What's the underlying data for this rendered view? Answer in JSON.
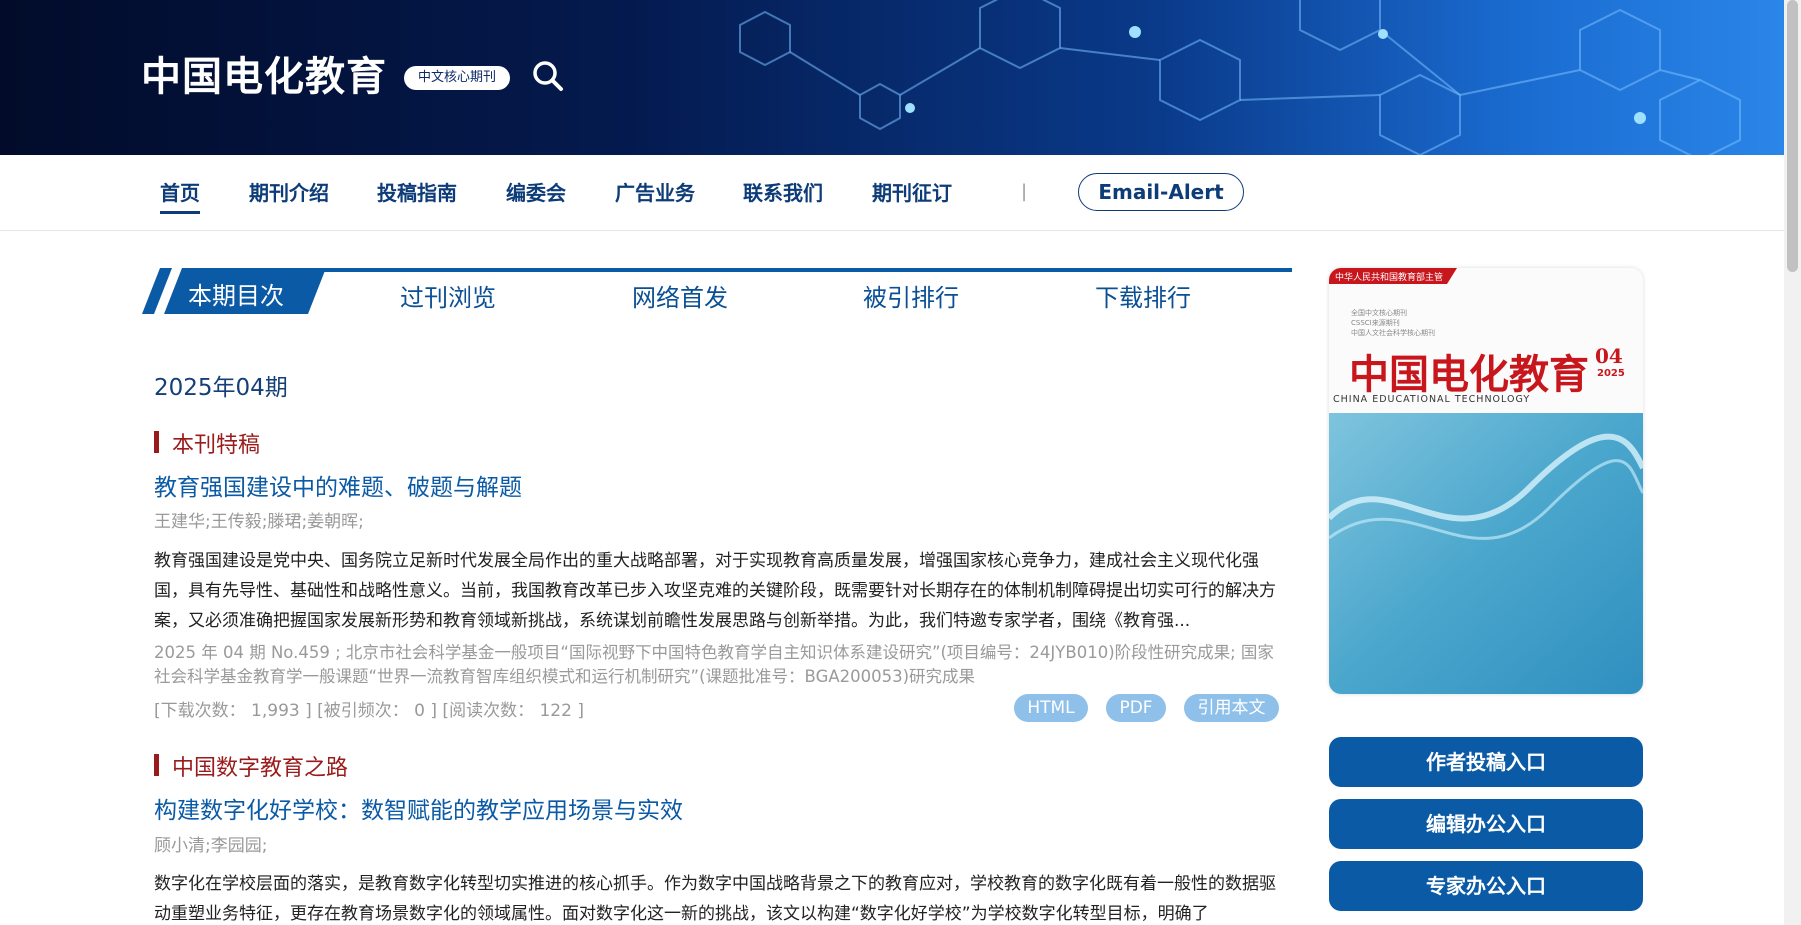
{
  "header": {
    "site_title": "中国电化教育",
    "badge": "中文核心期刊"
  },
  "nav": {
    "items": [
      "首页",
      "期刊介绍",
      "投稿指南",
      "编委会",
      "广告业务",
      "联系我们",
      "期刊征订"
    ],
    "separator": "|",
    "email_alert": "Email-Alert"
  },
  "tabs": [
    "本期目次",
    "过刊浏览",
    "网络首发",
    "被引排行",
    "下载排行"
  ],
  "issue_title": "2025年04期",
  "sections": [
    {
      "heading": "本刊特稿",
      "article": {
        "title": "教育强国建设中的难题、破题与解题",
        "authors": "王建华;王传毅;滕珺;姜朝晖;",
        "abstract": "教育强国建设是党中央、国务院立足新时代发展全局作出的重大战略部署，对于实现教育高质量发展，增强国家核心竞争力，建成社会主义现代化强国，具有先导性、基础性和战略性意义。当前，我国教育改革已步入攻坚克难的关键阶段，既需要针对长期存在的体制机制障碍提出切实可行的解决方案，又必须准确把握国家发展新形势和教育领域新挑战，系统谋划前瞻性发展思路与创新举措。为此，我们特邀专家学者，围绕《教育强...",
        "meta": "2025 年 04 期 No.459 ;  北京市社会科学基金一般项目“国际视野下中国特色教育学自主知识体系建设研究”(项目编号：24JYB010)阶段性研究成果; 国家社会科学基金教育学一般课题“世界一流教育智库组织模式和运行机制研究”(课题批准号：BGA200053)研究成果",
        "stats": "[下载次数：  1,993 ] [被引频次：  0 ] [阅读次数：  122 ]",
        "buttons": [
          "HTML",
          "PDF",
          "引用本文"
        ]
      }
    },
    {
      "heading": "中国数字教育之路",
      "article": {
        "title": "构建数字化好学校：数智赋能的教学应用场景与实效",
        "authors": "顾小清;李园园;",
        "abstract": "数字化在学校层面的落实，是教育数字化转型切实推进的核心抓手。作为数字中国战略背景之下的教育应对，学校教育的数字化既有着一般性的数据驱动重塑业务特征，更存在教育场景数字化的领域属性。面对数字化这一新的挑战，该文以构建“数字化好学校”为学校数字化转型目标，明确了"
      }
    }
  ],
  "cover": {
    "top_band": "中华人民共和国教育部主管",
    "small_lines": [
      "全国中文核心期刊",
      "CSSCI来源期刊",
      "中国人文社会科学核心期刊"
    ],
    "title": "中国电化教育",
    "issue_no": "04",
    "year": "2025",
    "subtitle": "CHINA EDUCATIONAL TECHNOLOGY"
  },
  "entries": [
    "作者投稿入口",
    "编辑办公入口",
    "专家办公入口"
  ],
  "colors": {
    "brand_blue": "#0b5aa6",
    "nav_text": "#0d3c78",
    "section_red": "#9a1b1b",
    "pill": "#8ec0ea"
  }
}
